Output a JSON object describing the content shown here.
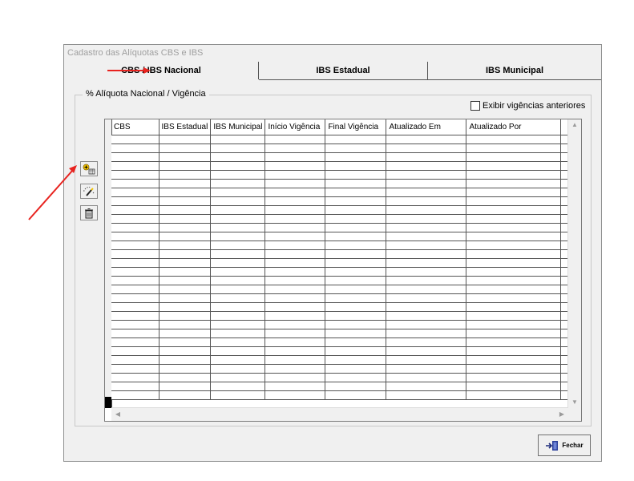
{
  "window": {
    "title": "Cadastro das Alíquotas CBS e IBS"
  },
  "tabs": [
    {
      "label": "CBS / IBS Nacional",
      "active": true
    },
    {
      "label": "IBS Estadual",
      "active": false
    },
    {
      "label": "IBS Municipal",
      "active": false
    }
  ],
  "group": {
    "legend": "% Alíquota Nacional / Vigência"
  },
  "checkbox": {
    "label": "Exibir vigências anteriores",
    "checked": false
  },
  "grid": {
    "columns": [
      "CBS",
      "IBS Estadual",
      "IBS Municipal",
      "Início Vigência",
      "Final Vigência",
      "Atualizado Em",
      "Atualizado Por",
      ""
    ],
    "row_count": 30
  },
  "buttons": {
    "add_icon": "add-icon",
    "edit_icon": "edit-wand-icon",
    "delete_icon": "trash-icon",
    "close_label": "Fechar",
    "close_icon": "exit-door-icon"
  },
  "annotation_color": "#e8231f"
}
